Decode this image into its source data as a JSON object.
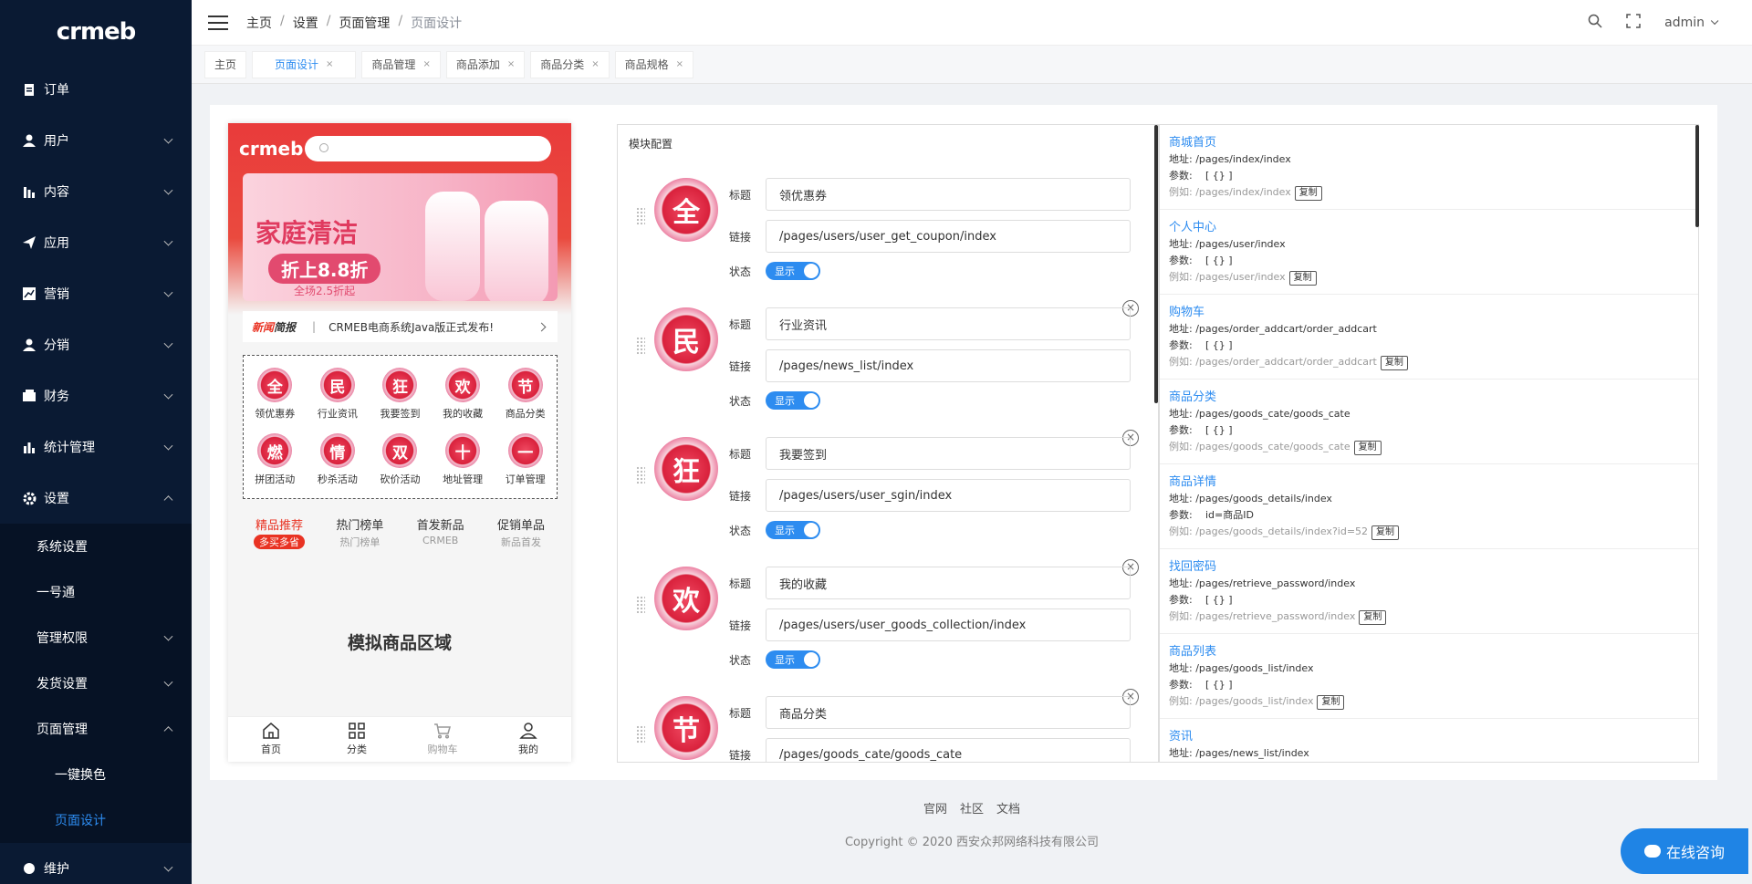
{
  "brand": {
    "logo": "crmeb"
  },
  "sidebar": {
    "items": [
      {
        "label": "订单"
      },
      {
        "label": "用户"
      },
      {
        "label": "内容"
      },
      {
        "label": "应用"
      },
      {
        "label": "营销"
      },
      {
        "label": "分销"
      },
      {
        "label": "财务"
      },
      {
        "label": "统计管理"
      },
      {
        "label": "设置"
      }
    ],
    "settings_children": [
      "系统设置",
      "一号通",
      "管理权限",
      "发货设置",
      "页面管理"
    ],
    "page_children": [
      "一键换色",
      "页面设计"
    ],
    "maintenance": "维护"
  },
  "header": {
    "breadcrumb": [
      "主页",
      "设置",
      "页面管理",
      "页面设计"
    ],
    "user": "admin"
  },
  "tabs": [
    {
      "label": "主页"
    },
    {
      "label": "页面设计"
    },
    {
      "label": "商品管理"
    },
    {
      "label": "商品添加"
    },
    {
      "label": "商品分类"
    },
    {
      "label": "商品规格"
    }
  ],
  "phone": {
    "logo": "crmeb",
    "banner_title": "家庭清洁",
    "banner_sub": "折上8.8折",
    "banner_note": "全场2.5折起",
    "news_label_a": "新闻",
    "news_label_b": "简报",
    "news_text": "CRMEB电商系统Java版正式发布!",
    "nav": [
      {
        "char": "全",
        "label": "领优惠券"
      },
      {
        "char": "民",
        "label": "行业资讯"
      },
      {
        "char": "狂",
        "label": "我要签到"
      },
      {
        "char": "欢",
        "label": "我的收藏"
      },
      {
        "char": "节",
        "label": "商品分类"
      },
      {
        "char": "燃",
        "label": "拼团活动"
      },
      {
        "char": "情",
        "label": "秒杀活动"
      },
      {
        "char": "双",
        "label": "砍价活动"
      },
      {
        "char": "十",
        "label": "地址管理"
      },
      {
        "char": "一",
        "label": "订单管理"
      }
    ],
    "hot": [
      {
        "title": "精品推荐",
        "sub": "多买多省"
      },
      {
        "title": "热门榜单",
        "sub": "热门榜单"
      },
      {
        "title": "首发新品",
        "sub": "CRMEB"
      },
      {
        "title": "促销单品",
        "sub": "新品首发"
      }
    ],
    "mock_area": "模拟商品区域",
    "tabbar": [
      "首页",
      "分类",
      "购物车",
      "我的"
    ]
  },
  "config": {
    "title": "模块配置",
    "label_title": "标题",
    "label_link": "链接",
    "label_status": "状态",
    "toggle_text": "显示",
    "items": [
      {
        "char": "全",
        "title": "领优惠券",
        "link": "/pages/users/user_get_coupon/index"
      },
      {
        "char": "民",
        "title": "行业资讯",
        "link": "/pages/news_list/index"
      },
      {
        "char": "狂",
        "title": "我要签到",
        "link": "/pages/users/user_sgin/index"
      },
      {
        "char": "欢",
        "title": "我的收藏",
        "link": "/pages/users/user_goods_collection/index"
      },
      {
        "char": "节",
        "title": "商品分类",
        "link": "/pages/goods_cate/goods_cate"
      }
    ]
  },
  "links": {
    "addr_label": "地址:",
    "param_label": "参数:",
    "example_label": "例如:",
    "copy_label": "复制",
    "items": [
      {
        "name": "商城首页",
        "addr": "/pages/index/index",
        "param": "[ {} ]",
        "example": "/pages/index/index"
      },
      {
        "name": "个人中心",
        "addr": "/pages/user/index",
        "param": "[ {} ]",
        "example": "/pages/user/index"
      },
      {
        "name": "购物车",
        "addr": "/pages/order_addcart/order_addcart",
        "param": "[ {} ]",
        "example": "/pages/order_addcart/order_addcart"
      },
      {
        "name": "商品分类",
        "addr": "/pages/goods_cate/goods_cate",
        "param": "[ {} ]",
        "example": "/pages/goods_cate/goods_cate"
      },
      {
        "name": "商品详情",
        "addr": "/pages/goods_details/index",
        "param": "id=商品ID",
        "example": "/pages/goods_details/index?id=52"
      },
      {
        "name": "找回密码",
        "addr": "/pages/retrieve_password/index",
        "param": "[ {} ]",
        "example": "/pages/retrieve_password/index"
      },
      {
        "name": "商品列表",
        "addr": "/pages/goods_list/index",
        "param": "[ {} ]",
        "example": "/pages/goods_list/index"
      },
      {
        "name": "资讯",
        "addr": "/pages/news_list/index",
        "param": "[ {} ]",
        "example": ""
      }
    ]
  },
  "footer": {
    "links": [
      "官网",
      "社区",
      "文档"
    ],
    "copyright": "Copyright © 2020 西安众邦网络科技有限公司"
  },
  "chat": {
    "label": "在线咨询"
  }
}
